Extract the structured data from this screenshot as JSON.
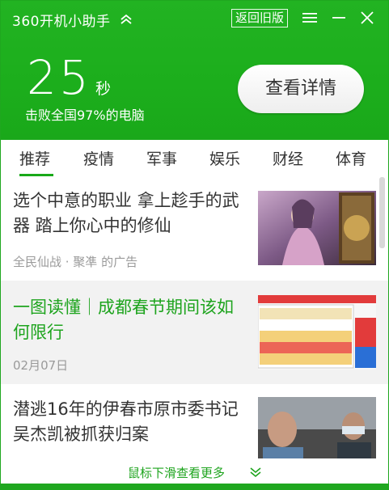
{
  "header": {
    "app_title": "360开机小助手",
    "legacy_label": "返回旧版",
    "score": "25",
    "score_unit": "秒",
    "score_desc": "击败全国97%的电脑",
    "detail_label": "查看详情"
  },
  "tabs": [
    {
      "label": "推荐",
      "active": true
    },
    {
      "label": "疫情"
    },
    {
      "label": "军事"
    },
    {
      "label": "娱乐"
    },
    {
      "label": "财经"
    },
    {
      "label": "体育"
    }
  ],
  "news": [
    {
      "title": "选个中意的职业 拿上趁手的武器 踏上你心中的修仙",
      "meta": "全民仙战 · 聚凖 的广告"
    },
    {
      "title": "一图读懂｜成都春节期间该如何限行",
      "meta": "02月07日",
      "title_color": "#1ea41e"
    },
    {
      "title": "潜逃16年的伊春市原市委书记吴杰凯被抓获归案",
      "meta": ""
    }
  ],
  "footer": {
    "hint": "鼠标下滑查看更多"
  },
  "colors": {
    "brand": "#1fa71f",
    "accent": "#1ea41e"
  }
}
